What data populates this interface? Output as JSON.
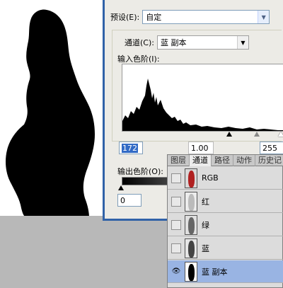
{
  "dialog": {
    "preset_label": "预设(E):",
    "preset_value": "自定",
    "channel_label": "通道(C):",
    "channel_value": "蓝 副本",
    "input_levels_label": "输入色阶(I):",
    "input_black": "172",
    "input_gamma": "1.00",
    "input_white": "255",
    "output_levels_label": "输出色阶(O):",
    "output_black": "0"
  },
  "panel": {
    "tabs": [
      "图层",
      "通道",
      "路径",
      "动作",
      "历史记"
    ],
    "active_tab": "通道",
    "channels": [
      {
        "name": "RGB",
        "visible": false,
        "selected": false,
        "thumb_color": "#b02020"
      },
      {
        "name": "红",
        "visible": false,
        "selected": false,
        "thumb_color": "#bbbbbb"
      },
      {
        "name": "绿",
        "visible": false,
        "selected": false,
        "thumb_color": "#666666"
      },
      {
        "name": "蓝",
        "visible": false,
        "selected": false,
        "thumb_color": "#444444"
      },
      {
        "name": "蓝 副本",
        "visible": true,
        "selected": true,
        "thumb_color": "#000000"
      }
    ]
  },
  "colors": {
    "dialog_bg": "#ecebe6",
    "selection_blue": "#316ac5",
    "selected_row": "#99b4e3",
    "window_border": "#3162a8"
  }
}
